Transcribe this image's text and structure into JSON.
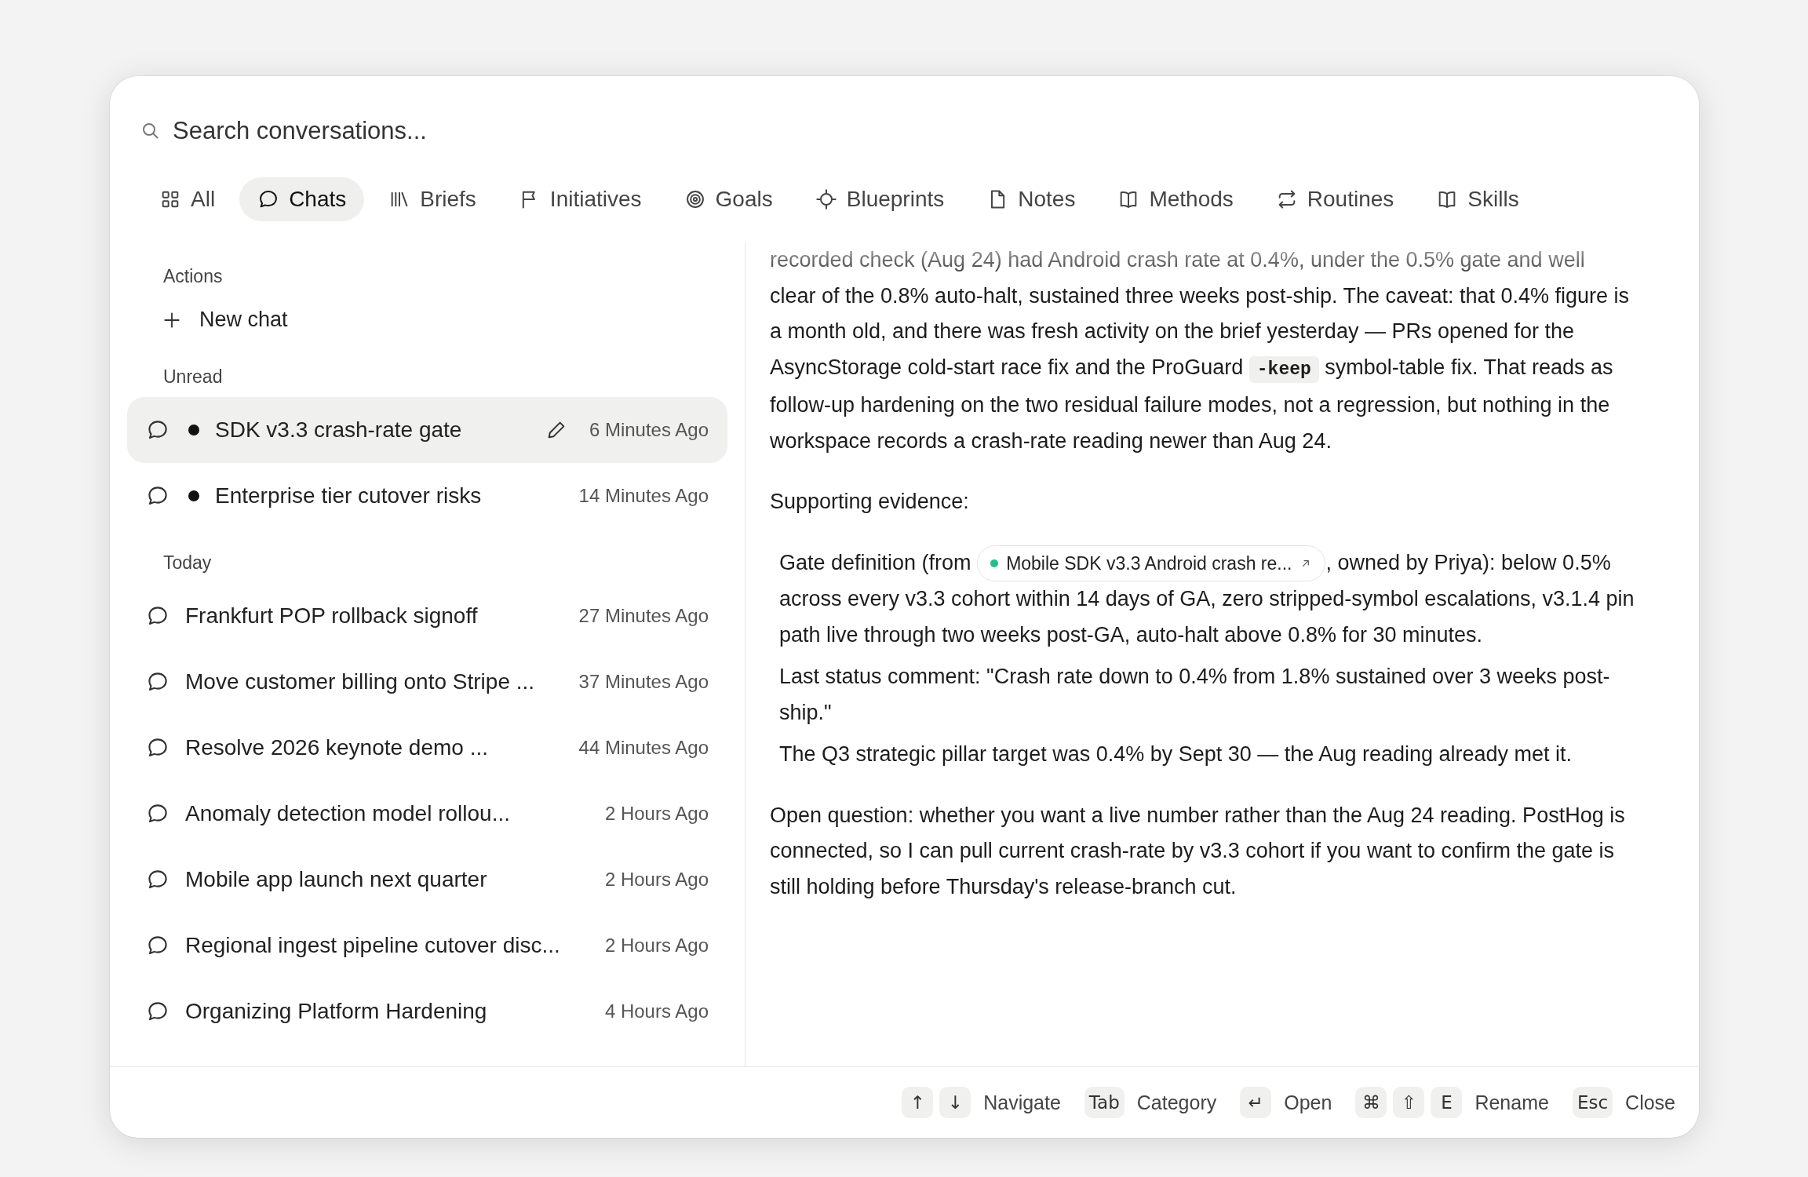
{
  "search": {
    "placeholder": "Search conversations..."
  },
  "tabs": [
    {
      "label": "All",
      "selected": false
    },
    {
      "label": "Chats",
      "selected": true
    },
    {
      "label": "Briefs",
      "selected": false
    },
    {
      "label": "Initiatives",
      "selected": false
    },
    {
      "label": "Goals",
      "selected": false
    },
    {
      "label": "Blueprints",
      "selected": false
    },
    {
      "label": "Notes",
      "selected": false
    },
    {
      "label": "Methods",
      "selected": false
    },
    {
      "label": "Routines",
      "selected": false
    },
    {
      "label": "Skills",
      "selected": false
    }
  ],
  "sidebar": {
    "sections": [
      {
        "title": "Actions",
        "kind": "actions",
        "items": [
          {
            "label": "New chat"
          }
        ]
      },
      {
        "title": "Unread",
        "kind": "chats",
        "items": [
          {
            "title": "SDK v3.3 crash-rate gate",
            "time": "6 Minutes Ago",
            "unread": true,
            "selected": true
          },
          {
            "title": "Enterprise tier cutover risks",
            "time": "14 Minutes Ago",
            "unread": true,
            "selected": false
          }
        ]
      },
      {
        "title": "Today",
        "kind": "chats",
        "items": [
          {
            "title": "Frankfurt POP rollback signoff",
            "time": "27 Minutes Ago",
            "unread": false,
            "selected": false
          },
          {
            "title": "Move customer billing onto Stripe ...",
            "time": "37 Minutes Ago",
            "unread": false,
            "selected": false
          },
          {
            "title": "Resolve 2026 keynote demo ...",
            "time": "44 Minutes Ago",
            "unread": false,
            "selected": false
          },
          {
            "title": "Anomaly detection model rollou...",
            "time": "2 Hours Ago",
            "unread": false,
            "selected": false
          },
          {
            "title": "Mobile app launch next quarter",
            "time": "2 Hours Ago",
            "unread": false,
            "selected": false
          },
          {
            "title": "Regional ingest pipeline cutover disc...",
            "time": "2 Hours Ago",
            "unread": false,
            "selected": false
          },
          {
            "title": "Organizing Platform Hardening",
            "time": "4 Hours Ago",
            "unread": false,
            "selected": false
          }
        ]
      }
    ]
  },
  "content": {
    "blocks": [
      {
        "kind": "paragraph",
        "segments": [
          {
            "kind": "text",
            "text": "recorded check (Aug 24) had Android crash rate at 0.4%, under the 0.5% gate and well clear of the 0.8% auto-halt, sustained three weeks post-ship. The caveat: that 0.4% figure is a month old, and there was fresh activity on the brief yesterday — PRs opened for the AsyncStorage cold-start race fix and the ProGuard "
          },
          {
            "kind": "code",
            "text": "-keep"
          },
          {
            "kind": "text",
            "text": " symbol-table fix. That reads as follow-up hardening on the two residual failure modes, not a regression, but nothing in the workspace records a crash-rate reading newer than Aug 24."
          }
        ]
      },
      {
        "kind": "paragraph",
        "segments": [
          {
            "kind": "text",
            "text": "Supporting evidence:"
          }
        ]
      },
      {
        "kind": "list",
        "items": [
          {
            "segments": [
              {
                "kind": "text",
                "text": "Gate definition (from "
              },
              {
                "kind": "reference",
                "text": "Mobile SDK v3.3 Android crash re...",
                "color": "#1fbf86"
              },
              {
                "kind": "text",
                "text": ", owned by Priya): below 0.5% across every v3.3 cohort within 14 days of GA, zero stripped-symbol escalations, v3.1.4 pin path live through two weeks post-GA, auto-halt above 0.8% for 30 minutes."
              }
            ]
          },
          {
            "segments": [
              {
                "kind": "text",
                "text": "Last status comment: \"Crash rate down to 0.4% from 1.8% sustained over 3 weeks post-ship.\""
              }
            ]
          },
          {
            "segments": [
              {
                "kind": "text",
                "text": "The Q3 strategic pillar target was 0.4% by Sept 30 — the Aug reading already met it."
              }
            ]
          }
        ]
      },
      {
        "kind": "paragraph",
        "segments": [
          {
            "kind": "text",
            "text": "Open question: whether you want a live number rather than the Aug 24 reading. PostHog is connected, so I can pull current crash-rate by v3.3 cohort if you want to confirm the gate is still holding before Thursday's release-branch cut."
          }
        ]
      }
    ]
  },
  "footer": {
    "shortcuts": [
      {
        "keys": [
          "↑",
          "↓"
        ],
        "label": "Navigate"
      },
      {
        "keys": [
          "Tab"
        ],
        "label": "Category"
      },
      {
        "keys": [
          "↵"
        ],
        "label": "Open"
      },
      {
        "keys": [
          "⌘",
          "⇧",
          "E"
        ],
        "label": "Rename"
      },
      {
        "keys": [
          "Esc"
        ],
        "label": "Close"
      }
    ]
  }
}
